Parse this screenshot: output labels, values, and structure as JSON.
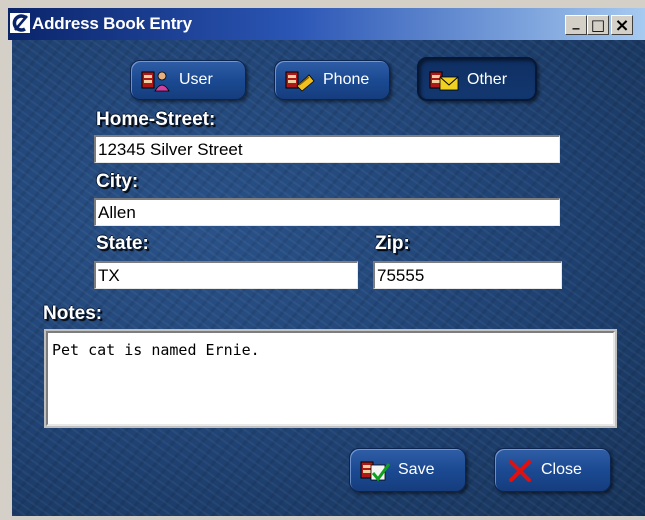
{
  "window": {
    "title": "Address Book Entry",
    "titlebar_buttons": {
      "minimize": "_",
      "maximize": "□",
      "close": "×"
    }
  },
  "tabs": [
    {
      "label": "User",
      "icon": "user-card-icon",
      "active": false
    },
    {
      "label": "Phone",
      "icon": "phone-card-icon",
      "active": false
    },
    {
      "label": "Other",
      "icon": "envelope-card-icon",
      "active": true
    }
  ],
  "form": {
    "home_street": {
      "label": "Home-Street:",
      "value": "12345 Silver Street"
    },
    "city": {
      "label": "City:",
      "value": "Allen"
    },
    "state": {
      "label": "State:",
      "value": "TX"
    },
    "zip": {
      "label": "Zip:",
      "value": "75555"
    },
    "notes": {
      "label": "Notes:",
      "value": "Pet cat is named Ernie."
    }
  },
  "actions": {
    "save_label": "Save",
    "close_label": "Close"
  },
  "colors": {
    "background": "#1e3f6a",
    "button": "#1b4a93",
    "titlebar_start": "#0a246a",
    "titlebar_end": "#a6caf0"
  }
}
